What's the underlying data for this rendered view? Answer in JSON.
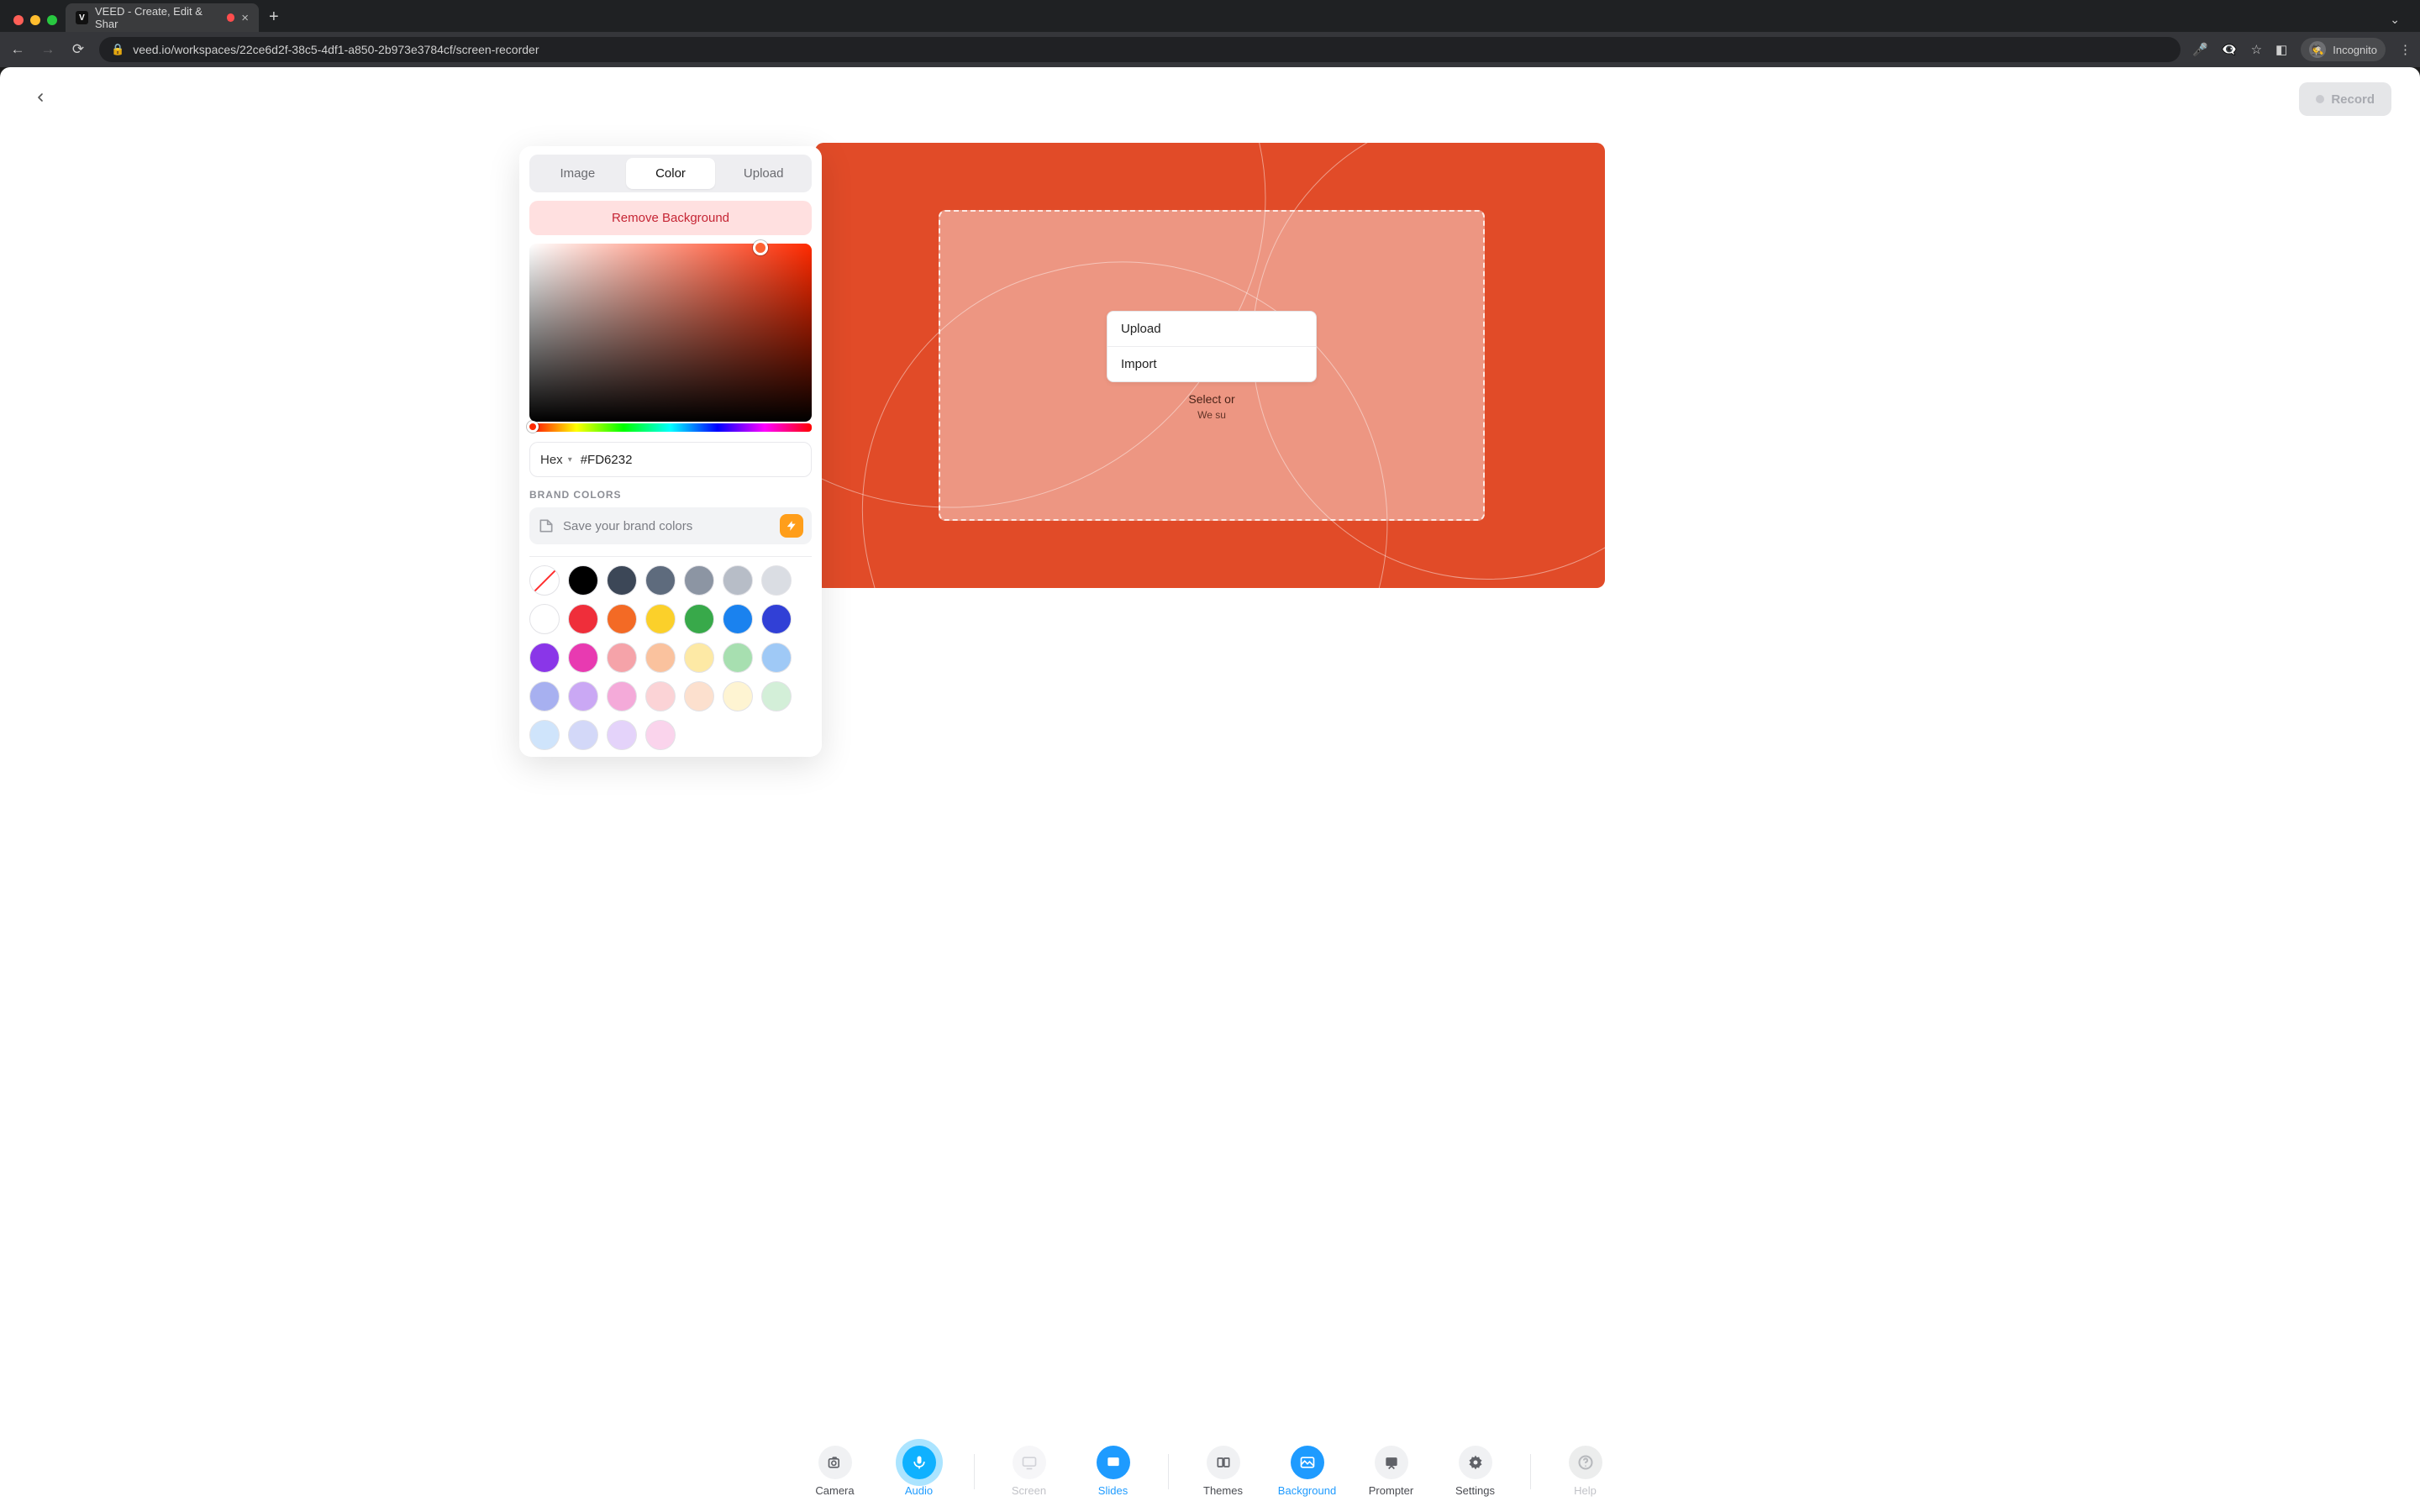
{
  "browser": {
    "tab_title": "VEED - Create, Edit & Shar",
    "url": "veed.io/workspaces/22ce6d2f-38c5-4df1-a850-2b973e3784cf/screen-recorder",
    "incognito_label": "Incognito"
  },
  "header": {
    "record_label": "Record"
  },
  "canvas": {
    "upload_label": "Upload",
    "import_label": "Import",
    "hint_line1": "Select or",
    "hint_line2": "We su"
  },
  "popover": {
    "tabs": {
      "image": "Image",
      "color": "Color",
      "upload": "Upload"
    },
    "remove_bg": "Remove Background",
    "hex_format": "Hex",
    "hex_value": "#FD6232",
    "brand_label": "BRAND COLORS",
    "brand_save": "Save your brand colors",
    "swatches": [
      "none",
      "#000000",
      "#3c4757",
      "#5e6b7d",
      "#8c95a3",
      "#b7bdc7",
      "#dadde3",
      "#ffffff",
      "#ef2e3a",
      "#f36a25",
      "#fbd02a",
      "#38a94a",
      "#1a82ef",
      "#3140d6",
      "#8a36e8",
      "#e83ab1",
      "#f5a3a9",
      "#fac29e",
      "#fde9a5",
      "#a7dfb0",
      "#9fc9f6",
      "#a7b0f0",
      "#caa8f4",
      "#f4aad9",
      "#fbd3d6",
      "#fce0ce",
      "#fef4d2",
      "#d3efd8",
      "#cfe4fb",
      "#d3d8f8",
      "#e4d3fa",
      "#fad4ec"
    ]
  },
  "toolbar": {
    "camera": "Camera",
    "audio": "Audio",
    "screen": "Screen",
    "slides": "Slides",
    "themes": "Themes",
    "background": "Background",
    "prompter": "Prompter",
    "settings": "Settings",
    "help": "Help"
  }
}
